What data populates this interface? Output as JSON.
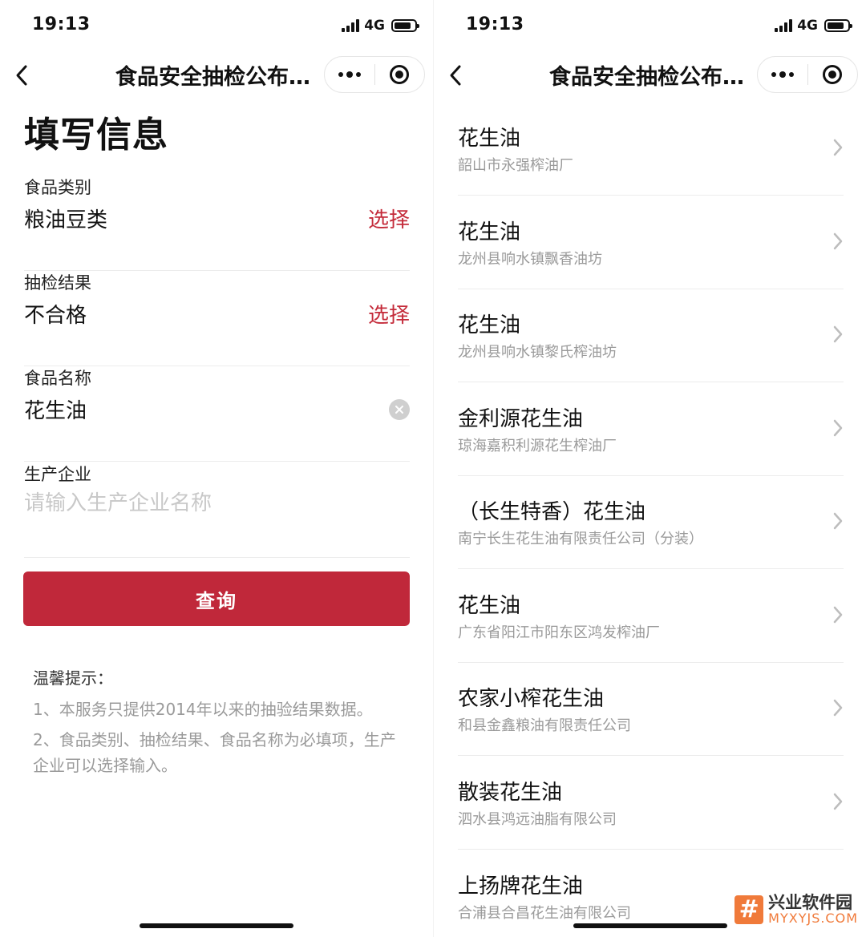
{
  "status": {
    "time": "19:13",
    "network": "4G"
  },
  "nav": {
    "title": "食品安全抽检公布…"
  },
  "form": {
    "title": "填写信息",
    "fields": [
      {
        "label": "食品类别",
        "value": "粮油豆类",
        "action": "选择"
      },
      {
        "label": "抽检结果",
        "value": "不合格",
        "action": "选择"
      },
      {
        "label": "食品名称",
        "value": "花生油"
      },
      {
        "label": "生产企业",
        "placeholder": "请输入生产企业名称"
      }
    ],
    "query_label": "查询",
    "tips": {
      "title": "温馨提示：",
      "line1": "1、本服务只提供2014年以来的抽验结果数据。",
      "line2": "2、食品类别、抽检结果、食品名称为必填项，生产企业可以选择输入。"
    }
  },
  "results": [
    {
      "name": "花生油",
      "company": "韶山市永强榨油厂"
    },
    {
      "name": "花生油",
      "company": "龙州县响水镇飘香油坊"
    },
    {
      "name": "花生油",
      "company": "龙州县响水镇黎氏榨油坊"
    },
    {
      "name": "金利源花生油",
      "company": "琼海嘉积利源花生榨油厂"
    },
    {
      "name": "（长生特香）花生油",
      "company": "南宁长生花生油有限责任公司（分装）"
    },
    {
      "name": "花生油",
      "company": "广东省阳江市阳东区鸿发榨油厂"
    },
    {
      "name": "农家小榨花生油",
      "company": "和县金鑫粮油有限责任公司"
    },
    {
      "name": "散装花生油",
      "company": "泗水县鸿远油脂有限公司"
    },
    {
      "name": "上扬牌花生油",
      "company": "合浦县合昌花生油有限公司"
    }
  ],
  "watermark": {
    "icon": "#",
    "name": "兴业软件园",
    "domain": "MYXYJS.COM"
  },
  "colors": {
    "accent": "#c0283a",
    "action_text": "#c42b3a",
    "watermark": "#f07a3a"
  }
}
